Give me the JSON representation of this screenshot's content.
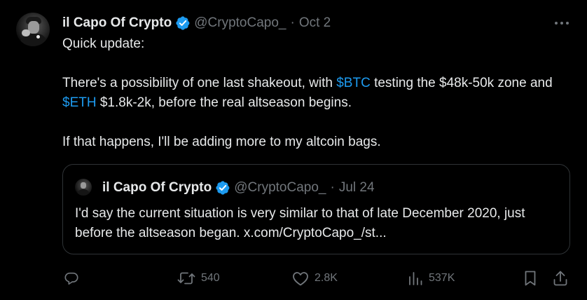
{
  "tweet": {
    "author_name": "il Capo Of Crypto",
    "handle": "@CryptoCapo_",
    "separator": "·",
    "date": "Oct 2",
    "line1": "Quick update:",
    "para2_part1": "There's a possibility of one last shakeout, with ",
    "cashtag_btc": "$BTC",
    "para2_part2": " testing the $48k-50k zone and ",
    "cashtag_eth": "$ETH",
    "para2_part3": " $1.8k-2k, before the real altseason begins.",
    "para3": "If that happens, I'll be adding more to my altcoin bags."
  },
  "quote": {
    "author_name": "il Capo Of Crypto",
    "handle": "@CryptoCapo_",
    "separator": "·",
    "date": "Jul 24",
    "text": "I'd say the current situation is very similar to that of late December 2020, just before the altseason began. x.com/CryptoCapo_/st..."
  },
  "actions": {
    "reply_count": "",
    "retweet_count": "540",
    "like_count": "2.8K",
    "views_count": "537K"
  },
  "icons": {
    "verified": "verified-badge-icon",
    "more": "more-options-icon",
    "reply": "reply-icon",
    "retweet": "retweet-icon",
    "like": "heart-icon",
    "views": "views-icon",
    "bookmark": "bookmark-icon",
    "share": "share-icon"
  },
  "colors": {
    "background": "#000000",
    "text": "#e7e9ea",
    "muted": "#71767b",
    "accent": "#1d9bf0",
    "border": "#2f3336"
  }
}
